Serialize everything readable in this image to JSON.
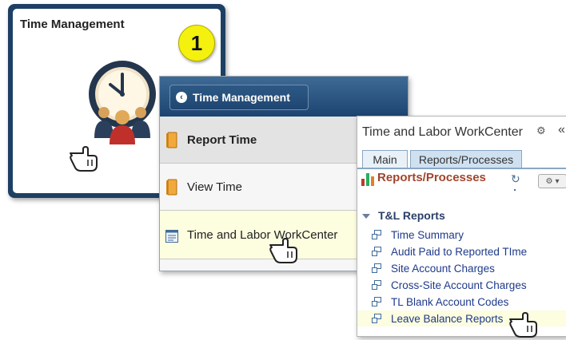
{
  "tile": {
    "title": "Time Management",
    "step_number": "1",
    "icon": "clock-people-icon"
  },
  "nav": {
    "back_label": "Time Management",
    "items": [
      {
        "label": "Report Time",
        "icon": "folder-icon",
        "state": "active"
      },
      {
        "label": "View Time",
        "icon": "folder-icon",
        "state": "normal"
      },
      {
        "label": "Time and Labor WorkCenter",
        "icon": "window-icon",
        "state": "highlighted"
      }
    ]
  },
  "workcenter": {
    "title": "Time and Labor WorkCenter",
    "tabs": [
      {
        "label": "Main",
        "active": false
      },
      {
        "label": "Reports/Processes",
        "active": true
      }
    ],
    "section_title": "Reports/Processes",
    "group_label": "T&L Reports",
    "links": [
      {
        "label": "Time Summary",
        "highlighted": false
      },
      {
        "label": "Audit Paid to Reported TIme",
        "highlighted": false
      },
      {
        "label": "Site Account Charges",
        "highlighted": false
      },
      {
        "label": "Cross-Site Account Charges",
        "highlighted": false
      },
      {
        "label": "TL Blank Account Codes",
        "highlighted": false
      },
      {
        "label": "Leave Balance Reports",
        "highlighted": true
      }
    ]
  },
  "colors": {
    "tile_border": "#1d3f63",
    "nav_header": "#1d4470",
    "badge": "#f4f10f",
    "section_title": "#a0452c",
    "link": "#1e3a8a",
    "highlight": "#fdfde0"
  }
}
